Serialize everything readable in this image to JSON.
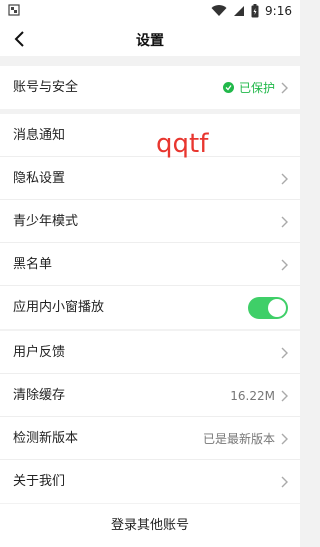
{
  "status_bar": {
    "time": "9:16"
  },
  "header": {
    "title": "设置"
  },
  "groups": [
    {
      "items": [
        {
          "label": "账号与安全",
          "value": "已保护"
        }
      ]
    },
    {
      "items": [
        {
          "label": "消息通知"
        },
        {
          "label": "隐私设置"
        },
        {
          "label": "青少年模式"
        },
        {
          "label": "黑名单"
        },
        {
          "label": "应用内小窗播放",
          "toggle_on": true
        }
      ]
    },
    {
      "items": [
        {
          "label": "用户反馈"
        },
        {
          "label": "清除缓存",
          "value": "16.22M"
        },
        {
          "label": "检测新版本",
          "value": "已是最新版本"
        },
        {
          "label": "关于我们"
        }
      ]
    }
  ],
  "watermark": "qqtf",
  "footer": {
    "button_label": "登录其他账号"
  },
  "colors": {
    "accent_green": "#21b84a",
    "toggle_green": "#3fcf68",
    "watermark_red": "#e8362f"
  }
}
